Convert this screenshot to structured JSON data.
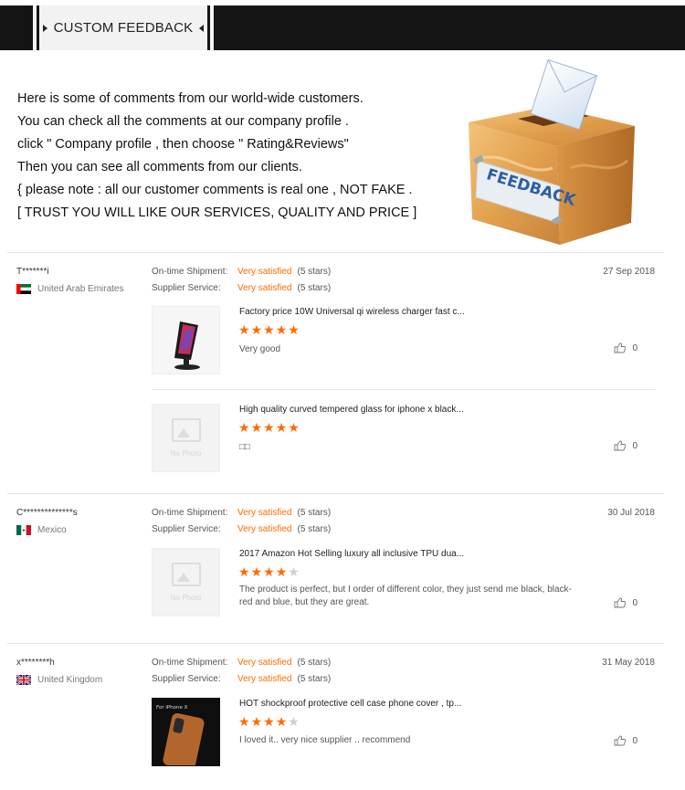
{
  "header": {
    "title": "CUSTOM FEEDBACK"
  },
  "intro": {
    "lines": [
      "Here is some of comments from our world-wide customers.",
      "You can check all the comments at our company profile .",
      "click \" Company profile , then choose \" Rating&Reviews\"",
      "Then you can see all comments from our clients.",
      "{ please note : all our customer comments is real one , NOT FAKE .",
      "[ TRUST YOU WILL LIKE OUR SERVICES, QUALITY AND PRICE ]"
    ]
  },
  "illustration": {
    "box_label": "FEEDBACK"
  },
  "labels": {
    "ontime": "On-time Shipment:",
    "supplier": "Supplier Service:",
    "no_photo": "No Photo"
  },
  "colors": {
    "accent": "#ff6a00",
    "header_bg": "#141414"
  },
  "reviews": [
    {
      "user": "T*******i",
      "country": "United Arab Emirates",
      "flag": "uae",
      "date": "27 Sep 2018",
      "ontime_value": "Very satisfied",
      "ontime_stars": "(5 stars)",
      "service_value": "Very satisfied",
      "service_stars": "(5 stars)",
      "items": [
        {
          "product": "Factory price 10W Universal qi wireless charger fast c...",
          "rating": 5,
          "comment": "Very good",
          "likes": "0",
          "photo": "charger"
        },
        {
          "product": "High quality curved tempered glass for iphone x black...",
          "rating": 5,
          "comment": "□□",
          "likes": "0",
          "photo": "none"
        }
      ]
    },
    {
      "user": "C**************s",
      "country": "Mexico",
      "flag": "mexico",
      "date": "30 Jul 2018",
      "ontime_value": "Very satisfied",
      "ontime_stars": "(5 stars)",
      "service_value": "Very satisfied",
      "service_stars": "(5 stars)",
      "items": [
        {
          "product": "2017 Amazon Hot Selling luxury all inclusive TPU dua...",
          "rating": 4,
          "comment": "The product is perfect, but I order of different color, they just send me black, black-red and blue, but they are great.",
          "likes": "0",
          "photo": "none"
        }
      ]
    },
    {
      "user": "x********h",
      "country": "United Kingdom",
      "flag": "uk",
      "date": "31 May 2018",
      "ontime_value": "Very satisfied",
      "ontime_stars": "(5 stars)",
      "service_value": "Very satisfied",
      "service_stars": "(5 stars)",
      "items": [
        {
          "product": "HOT shockproof protective cell case phone cover , tp...",
          "rating": 4,
          "comment": "I loved it.. very nice supplier .. recommend",
          "likes": "0",
          "photo": "case",
          "photo_text": "For iPhone X"
        }
      ]
    }
  ]
}
